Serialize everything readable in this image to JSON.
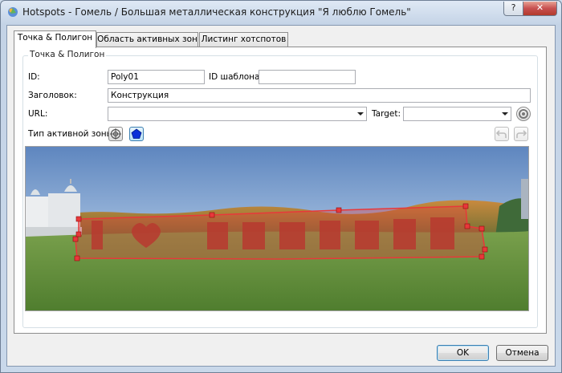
{
  "window": {
    "title": "Hotspots - Гомель / Большая металлическая конструкция \"Я люблю Гомель\"",
    "help_label": "?",
    "close_label": "✕"
  },
  "tabs": [
    {
      "label": "Точка & Полигон",
      "active": true
    },
    {
      "label": "Область активных зон",
      "active": false
    },
    {
      "label": "Листинг хотспотов",
      "active": false
    }
  ],
  "group": {
    "label": "Точка & Полигон"
  },
  "form": {
    "id_label": "ID:",
    "id_value": "Poly01",
    "template_id_label": "ID шаблона:",
    "template_id_value": "",
    "heading_label": "Заголовок:",
    "heading_value": "Конструкция",
    "url_label": "URL:",
    "url_value": "",
    "target_label": "Target:",
    "target_value": "",
    "zone_type_label": "Тип активной зоны:"
  },
  "image": {
    "polygon_color": "#e8383a",
    "description": "panorama"
  },
  "buttons": {
    "ok": "OK",
    "cancel": "Отмена"
  },
  "colors": {
    "accent": "#3c7fb1",
    "polygon": "#e8383a",
    "close": "#c75050"
  }
}
